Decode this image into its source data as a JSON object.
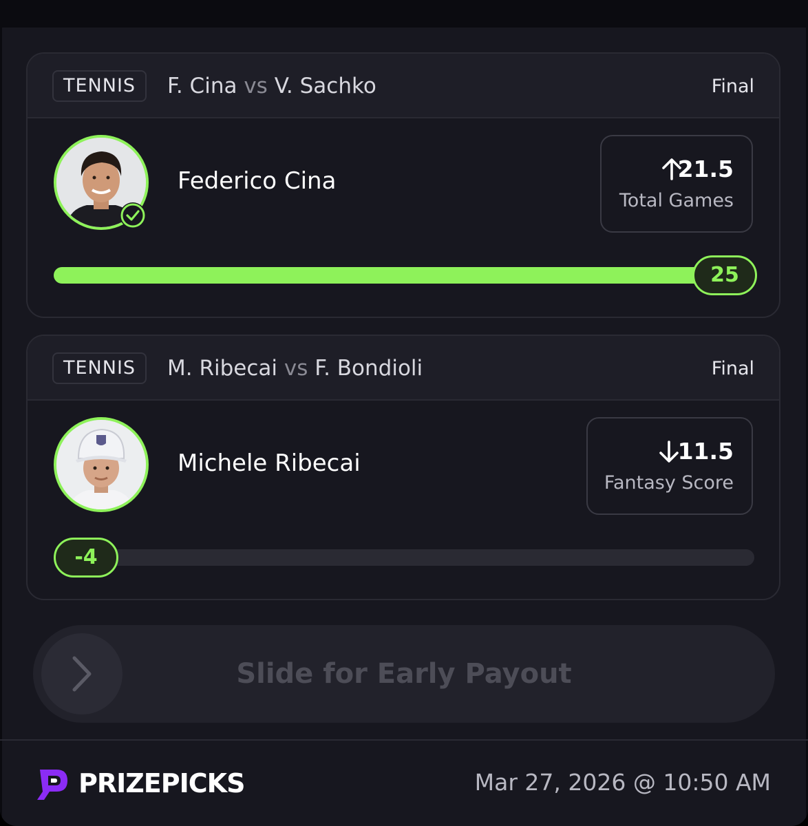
{
  "cards": [
    {
      "sport": "TENNIS",
      "team_a": "F. Cina",
      "vs": "vs",
      "team_b": "V. Sachko",
      "status": "Final",
      "player": "Federico Cina",
      "direction": "more",
      "line": "21.5",
      "stat": "Total Games",
      "result": "25",
      "progress": 1.0
    },
    {
      "sport": "TENNIS",
      "team_a": "M. Ribecai",
      "vs": "vs",
      "team_b": "F. Bondioli",
      "status": "Final",
      "player": "Michele Ribecai",
      "direction": "less",
      "line": "11.5",
      "stat": "Fantasy Score",
      "result": "-4",
      "progress": 0.0
    }
  ],
  "slider": {
    "label": "Slide for Early Payout"
  },
  "footer": {
    "brand": "PRIZEPICKS",
    "timestamp": "Mar 27, 2026 @ 10:50 AM"
  },
  "colors": {
    "accent": "#8ef25a",
    "brand_purple": "#8b2cf5",
    "background": "#17171f"
  },
  "icons": [
    "check-circle-icon",
    "arrow-up-icon",
    "arrow-down-icon",
    "chevron-right-icon",
    "prizepicks-logo"
  ]
}
